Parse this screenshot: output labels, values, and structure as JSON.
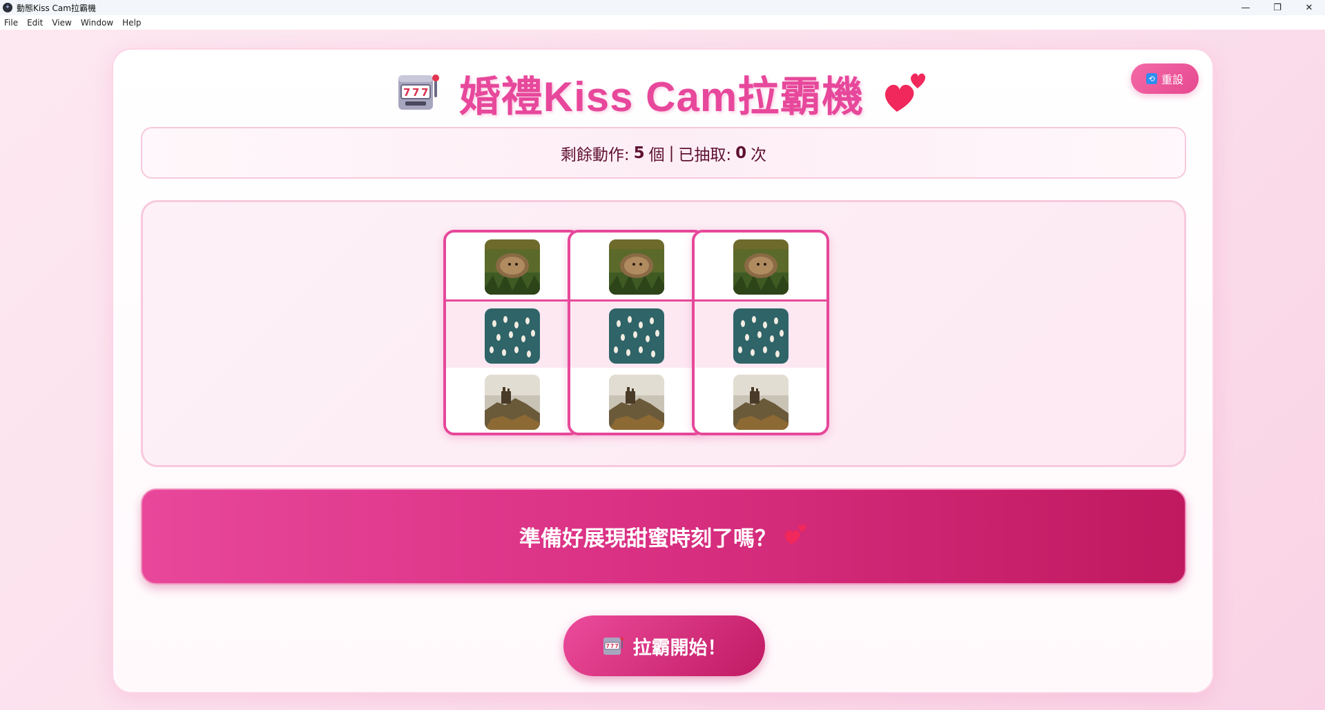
{
  "window": {
    "title": "動態Kiss Cam拉霸機",
    "minimize": "—",
    "maximize": "❐",
    "close": "✕"
  },
  "menu": [
    "File",
    "Edit",
    "View",
    "Window",
    "Help"
  ],
  "header": {
    "title": "婚禮Kiss Cam拉霸機",
    "left_icon": "slot-machine-icon",
    "right_icon": "two-hearts-icon"
  },
  "reset_button": {
    "label": "重設",
    "icon": "refresh-icon"
  },
  "stats": {
    "remaining_label": "剩餘動作:",
    "remaining_value": "5",
    "remaining_unit": "個",
    "separator": "|",
    "drawn_label": "已抽取:",
    "drawn_value": "0",
    "drawn_unit": "次"
  },
  "reels": [
    {
      "cells": [
        "hedgehog-thumbnail",
        "flamingos-thumbnail",
        "cliff-castle-thumbnail"
      ]
    },
    {
      "cells": [
        "hedgehog-thumbnail",
        "flamingos-thumbnail",
        "cliff-castle-thumbnail"
      ]
    },
    {
      "cells": [
        "hedgehog-thumbnail",
        "flamingos-thumbnail",
        "cliff-castle-thumbnail"
      ]
    }
  ],
  "message": {
    "text": "準備好展現甜蜜時刻了嗎？",
    "icon": "two-hearts-icon"
  },
  "spin_button": {
    "label": "拉霸開始！",
    "icon": "slot-machine-icon"
  },
  "colors": {
    "accent": "#e7489b",
    "accent_dark": "#c0195f",
    "background": "#fbe0ec"
  }
}
